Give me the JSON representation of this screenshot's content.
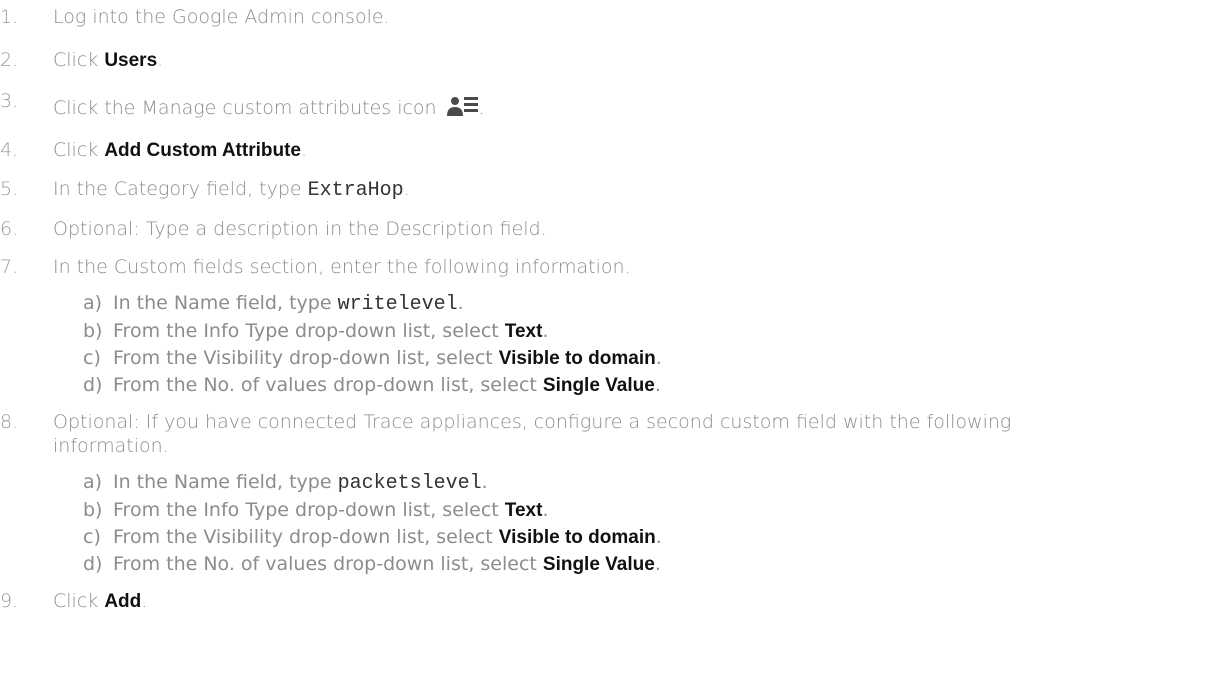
{
  "steps": [
    {
      "num": "1.",
      "text": "Log into the Google Admin console."
    },
    {
      "num": "2.",
      "pre": "Click ",
      "bold": "Users",
      "post": "."
    },
    {
      "num": "3.",
      "pre": "Click the Manage custom attributes icon ",
      "post": ".",
      "icon": "manage-custom-attributes-icon"
    },
    {
      "num": "4.",
      "pre": "Click ",
      "bold": "Add Custom Attribute",
      "post": "."
    },
    {
      "num": "5.",
      "pre": "In the Category field, type ",
      "code": "ExtraHop",
      "post": "."
    },
    {
      "num": "6.",
      "text": "Optional: Type a description in the Description field."
    },
    {
      "num": "7.",
      "text": "In the Custom fields section, enter the following information."
    },
    {
      "num": "8.",
      "line1": "Optional: If you have connected Trace appliances, configure a second custom field with the following",
      "line2": "information."
    },
    {
      "num": "9.",
      "pre": "Click ",
      "bold": "Add",
      "post": "."
    }
  ],
  "substeps_7": [
    {
      "letter": "a)",
      "pre": "In the Name field, type ",
      "code": "writelevel",
      "post": "."
    },
    {
      "letter": "b)",
      "pre": "From the Info Type drop-down list, select ",
      "bold": "Text",
      "post": "."
    },
    {
      "letter": "c)",
      "pre": "From the Visibility drop-down list, select ",
      "bold": "Visible to domain",
      "post": "."
    },
    {
      "letter": "d)",
      "pre": "From the No. of values drop-down list, select ",
      "bold": "Single Value",
      "post": "."
    }
  ],
  "substeps_8": [
    {
      "letter": "a)",
      "pre": "In the Name field, type ",
      "code": "packetslevel",
      "post": "."
    },
    {
      "letter": "b)",
      "pre": "From the Info Type drop-down list, select ",
      "bold": "Text",
      "post": "."
    },
    {
      "letter": "c)",
      "pre": "From the Visibility drop-down list, select ",
      "bold": "Visible to domain",
      "post": "."
    },
    {
      "letter": "d)",
      "pre": "From the No. of values drop-down list, select ",
      "bold": "Single Value",
      "post": "."
    }
  ],
  "colors": {
    "text": "#8c8c8c",
    "bold": "#111111",
    "icon": "#4a4a4a"
  }
}
